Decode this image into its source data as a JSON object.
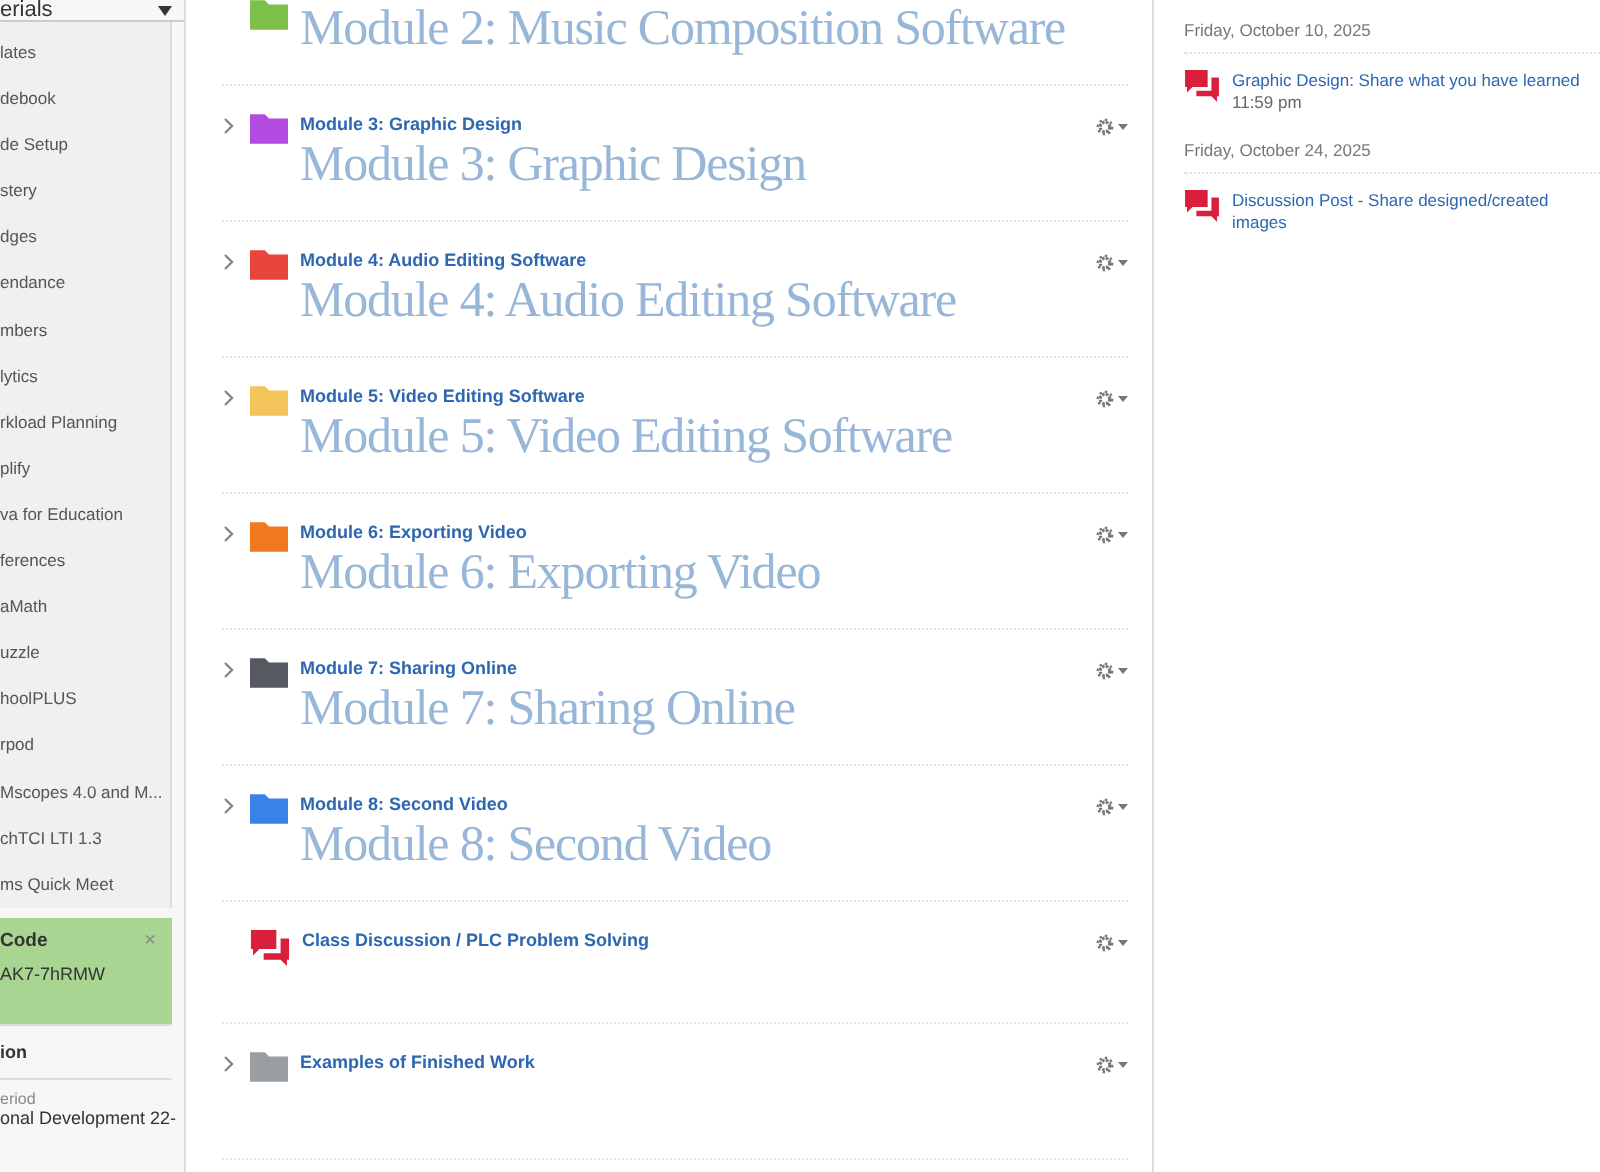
{
  "sidebar": {
    "header": "erials",
    "items": [
      "lates",
      "debook",
      "de Setup",
      "stery",
      "dges",
      "endance",
      "mbers",
      "lytics",
      "rkload Planning",
      "plify",
      "va for Education",
      "ferences",
      "aMath",
      "uzzle",
      "hoolPLUS",
      "rpod",
      "Mscopes 4.0 and M...",
      "chTCI LTI 1.3",
      "ms Quick Meet"
    ],
    "code_card": {
      "title": "Code",
      "close": "×",
      "code": "AK7-7hRMW"
    },
    "section": {
      "title": "ion",
      "label": "eriod",
      "value": "onal Development 22-"
    }
  },
  "modules": [
    {
      "kind": "folder",
      "color": "#7cc04a",
      "title": "Module 2: Music Composition Software"
    },
    {
      "kind": "folder",
      "color": "#b44be0",
      "subtitle": "Module 3: Graphic Design",
      "title": "Module 3: Graphic Design"
    },
    {
      "kind": "folder",
      "color": "#e8453c",
      "subtitle": "Module 4: Audio Editing Software",
      "title": "Module 4: Audio Editing Software"
    },
    {
      "kind": "folder",
      "color": "#f2c45a",
      "subtitle": "Module 5: Video Editing Software",
      "title": "Module 5: Video Editing Software"
    },
    {
      "kind": "folder",
      "color": "#f27a1e",
      "subtitle": "Module 6: Exporting Video",
      "title": "Module 6: Exporting Video"
    },
    {
      "kind": "folder",
      "color": "#555a60",
      "subtitle": "Module 7: Sharing Online",
      "title": "Module 7: Sharing Online"
    },
    {
      "kind": "folder",
      "color": "#3b82e8",
      "subtitle": "Module 8: Second Video",
      "title": "Module 8: Second Video"
    },
    {
      "kind": "discussion",
      "color": "#d8203c",
      "subtitle": "Class Discussion / PLC Problem Solving"
    },
    {
      "kind": "folder",
      "color": "#9a9ea3",
      "subtitle": "Examples of Finished Work"
    }
  ],
  "upcoming": [
    {
      "date": "Friday, October 10, 2025",
      "items": [
        {
          "title": "Graphic Design: Share what you have learned",
          "time": "11:59 pm"
        }
      ]
    },
    {
      "date": "Friday, October 24, 2025",
      "items": [
        {
          "title": "Discussion Post - Share designed/created images"
        }
      ]
    }
  ]
}
